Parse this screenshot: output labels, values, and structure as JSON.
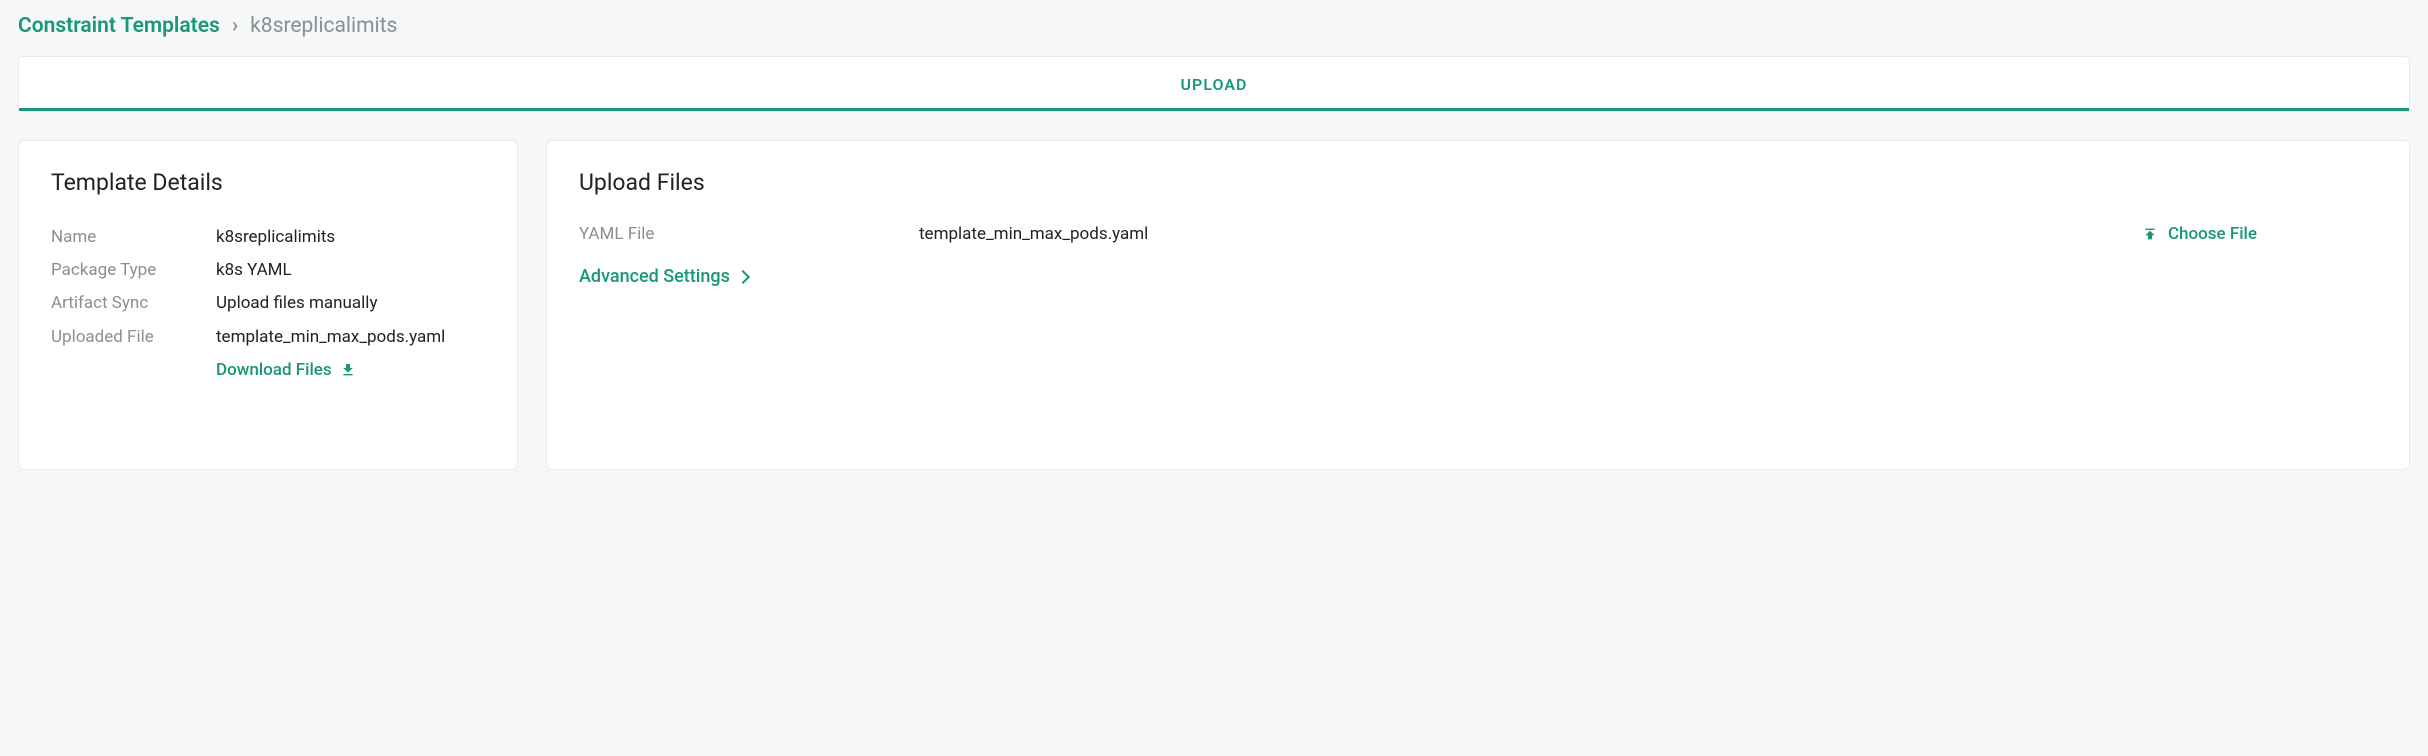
{
  "breadcrumb": {
    "parent": "Constraint Templates",
    "separator": "›",
    "current": "k8sreplicalimits"
  },
  "tabs": {
    "upload": "UPLOAD"
  },
  "details": {
    "title": "Template Details",
    "name_label": "Name",
    "name_value": "k8sreplicalimits",
    "package_type_label": "Package Type",
    "package_type_value": "k8s YAML",
    "artifact_sync_label": "Artifact Sync",
    "artifact_sync_value": "Upload files manually",
    "uploaded_file_label": "Uploaded File",
    "uploaded_file_value": "template_min_max_pods.yaml",
    "download_label": "Download Files"
  },
  "upload": {
    "title": "Upload Files",
    "yaml_label": "YAML File",
    "yaml_value": "template_min_max_pods.yaml",
    "choose_file": "Choose File",
    "advanced": "Advanced Settings"
  }
}
